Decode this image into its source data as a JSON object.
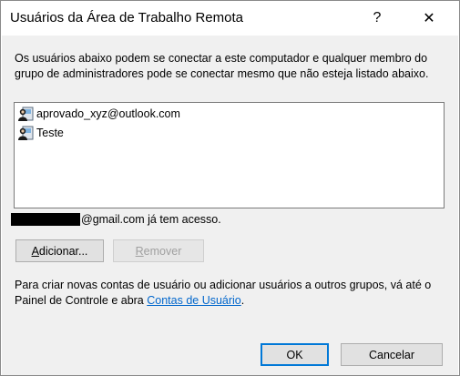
{
  "window": {
    "title": "Usuários da Área de Trabalho Remota",
    "help_glyph": "?",
    "close_glyph": "✕"
  },
  "description": "Os usuários abaixo podem se conectar a este computador e qualquer membro do grupo de administradores pode se conectar mesmo que não esteja listado abaixo.",
  "users": [
    {
      "name": "aprovado_xyz@outlook.com",
      "icon": "user-icon"
    },
    {
      "name": "Teste",
      "icon": "user-icon"
    }
  ],
  "access": {
    "suffix": "@gmail.com já tem acesso."
  },
  "buttons": {
    "add_accel": "A",
    "add_rest": "dicionar...",
    "remove_accel": "R",
    "remove_rest": "emover",
    "ok": "OK",
    "cancel": "Cancelar"
  },
  "footer": {
    "text": "Para criar novas contas de usuário ou adicionar usuários a outros grupos, vá até o Painel de Controle e abra ",
    "link": "Contas de Usuário",
    "end": "."
  }
}
